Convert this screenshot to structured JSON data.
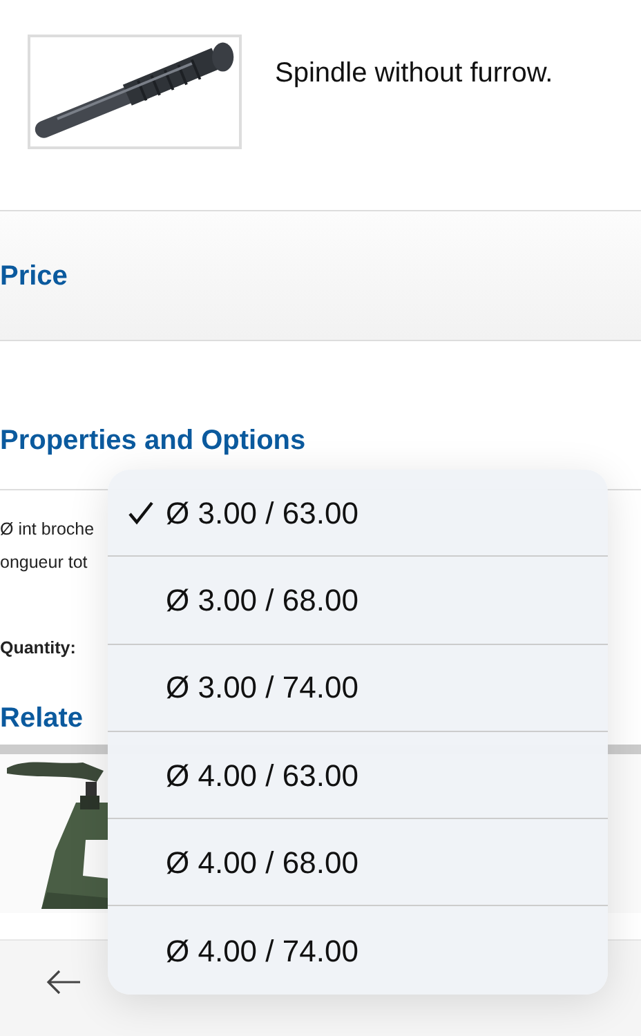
{
  "product": {
    "description": "Spindle without furrow."
  },
  "sections": [
    {
      "title": "Price"
    },
    {
      "title": "Properties and Options"
    }
  ],
  "properties": [
    {
      "label": "Ø int broche"
    },
    {
      "label": "ongueur tot"
    }
  ],
  "quantity": {
    "label": "Quantity:"
  },
  "related": {
    "title": "Relate"
  },
  "dropdown": {
    "options": [
      {
        "label": "Ø 3.00 / 63.00",
        "selected": true
      },
      {
        "label": "Ø 3.00 / 68.00",
        "selected": false
      },
      {
        "label": "Ø 3.00 / 74.00",
        "selected": false
      },
      {
        "label": "Ø 4.00 / 63.00",
        "selected": false
      },
      {
        "label": "Ø 4.00 / 68.00",
        "selected": false
      },
      {
        "label": "Ø 4.00 / 74.00",
        "selected": false
      }
    ]
  }
}
